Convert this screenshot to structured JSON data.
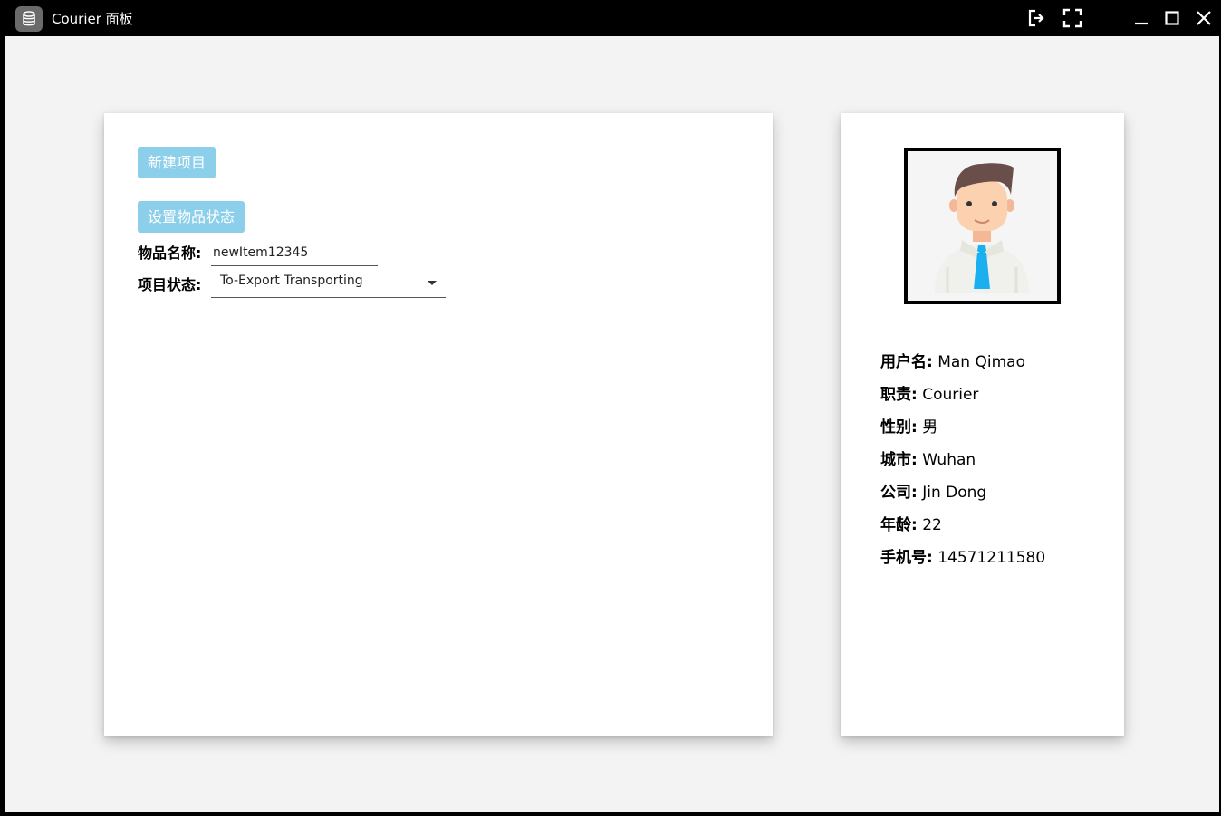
{
  "window": {
    "title": "Courier 面板"
  },
  "icons": {
    "app": "database-icon",
    "logout": "logout-icon",
    "fullscreen": "fullscreen-icon",
    "minimize": "minimize-icon",
    "maximize": "maximize-icon",
    "close": "close-icon"
  },
  "colors": {
    "button_bg": "#8ccfea",
    "titlebar": "#000000",
    "background": "#f3f3f3",
    "tie": "#1ab0f0"
  },
  "form": {
    "new_item_button": "新建项目",
    "set_status_button": "设置物品状态",
    "item_name_label": "物品名称:",
    "item_name_value": "newItem12345",
    "status_label": "项目状态:",
    "status_value": "To-Export Transporting"
  },
  "profile": {
    "rows": [
      {
        "label": "用户名:",
        "value": "Man Qimao"
      },
      {
        "label": "职责:",
        "value": "Courier"
      },
      {
        "label": "性别:",
        "value": "男"
      },
      {
        "label": "城市:",
        "value": "Wuhan"
      },
      {
        "label": "公司:",
        "value": "Jin Dong"
      },
      {
        "label": "年龄:",
        "value": "22"
      },
      {
        "label": "手机号:",
        "value": "14571211580"
      }
    ]
  }
}
